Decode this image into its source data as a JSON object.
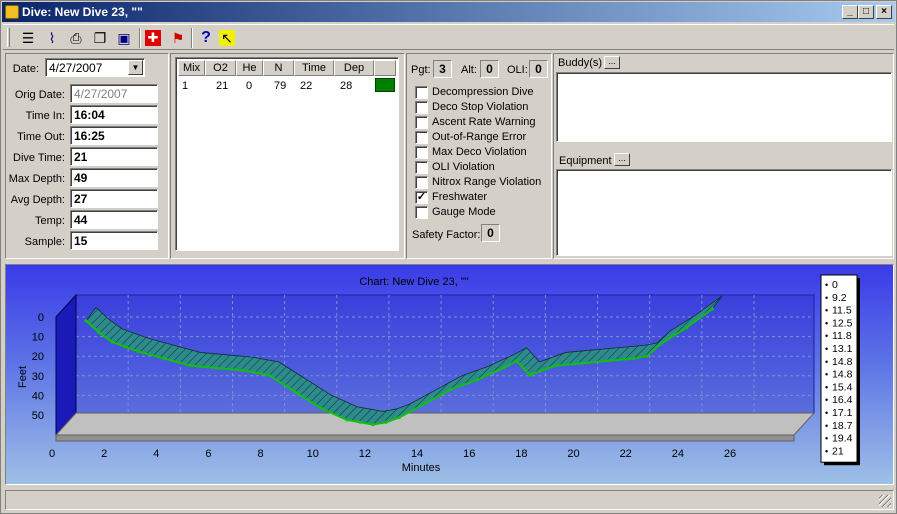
{
  "window": {
    "title": "Dive: New Dive 23, \"\"",
    "controls": [
      "_",
      "□",
      "×"
    ]
  },
  "toolbar": {
    "buttons": [
      {
        "name": "notes-icon",
        "glyph": "☰"
      },
      {
        "name": "chart-icon",
        "glyph": "⌇"
      },
      {
        "name": "print-icon",
        "glyph": "⎙"
      },
      {
        "name": "copy-icon",
        "glyph": "❐"
      },
      {
        "name": "save-icon",
        "glyph": "▣"
      },
      {
        "name": "first-aid-icon",
        "glyph": "✚"
      },
      {
        "name": "flag-icon",
        "glyph": "⚑"
      },
      {
        "name": "help-icon",
        "glyph": "?"
      },
      {
        "name": "pointer-icon",
        "glyph": "↖"
      }
    ]
  },
  "dive_info": {
    "date_label": "Date:",
    "date": "4/27/2007",
    "orig_date_label": "Orig Date:",
    "orig_date": "4/27/2007",
    "time_in_label": "Time In:",
    "time_in": "16:04",
    "time_out_label": "Time Out:",
    "time_out": "16:25",
    "dive_time_label": "Dive Time:",
    "dive_time": "21",
    "max_depth_label": "Max Depth:",
    "max_depth": "49",
    "avg_depth_label": "Avg Depth:",
    "avg_depth": "27",
    "temp_label": "Temp:",
    "temp": "44",
    "sample_label": "Sample:",
    "sample": "15"
  },
  "mix_table": {
    "headers": [
      "Mix",
      "O2",
      "He",
      "N",
      "Time",
      "Dep",
      ""
    ],
    "rows": [
      [
        "1",
        "21",
        "0",
        "79",
        "22",
        "28",
        ""
      ]
    ],
    "row_color": "#008000"
  },
  "status": {
    "pgt_label": "Pgt:",
    "pgt": "3",
    "alt_label": "Alt:",
    "alt": "0",
    "oli_label": "OLI:",
    "oli": "0",
    "safety_factor_label": "Safety Factor:",
    "safety_factor": "0",
    "flags": [
      {
        "label": "Decompression Dive",
        "checked": false
      },
      {
        "label": "Deco Stop Violation",
        "checked": false
      },
      {
        "label": "Ascent Rate Warning",
        "checked": false
      },
      {
        "label": "Out-of-Range Error",
        "checked": false
      },
      {
        "label": "Max Deco Violation",
        "checked": false
      },
      {
        "label": "OLI Violation",
        "checked": false
      },
      {
        "label": "Nitrox Range Violation",
        "checked": false
      },
      {
        "label": "Freshwater",
        "checked": true
      },
      {
        "label": "Gauge Mode",
        "checked": false
      }
    ]
  },
  "buddy": {
    "label": "Buddy(s)",
    "button": "..."
  },
  "equipment": {
    "label": "Equipment",
    "button": "..."
  },
  "chart_data": {
    "type": "area",
    "title": "Chart: New Dive 23, \"\"",
    "xlabel": "Minutes",
    "ylabel": "Feet",
    "xlim": [
      0,
      28
    ],
    "ylim": [
      0,
      50
    ],
    "y_reversed": true,
    "xticks": [
      "0",
      "2",
      "4",
      "6",
      "8",
      "10",
      "12",
      "14",
      "16",
      "18",
      "20",
      "22",
      "24",
      "26"
    ],
    "yticks": [
      "0",
      "10",
      "20",
      "30",
      "40",
      "50"
    ],
    "x": [
      0,
      0.5,
      1,
      1.5,
      2,
      3,
      4,
      5,
      6,
      7,
      8,
      9,
      10,
      10.5,
      11,
      11.5,
      12,
      13,
      14,
      15,
      16,
      16.5,
      17,
      18,
      19,
      20,
      21,
      21.5,
      22,
      23,
      24
    ],
    "y": [
      5,
      10,
      14,
      16,
      18,
      21,
      24,
      25,
      26,
      28,
      35,
      42,
      47,
      48,
      49,
      48,
      46,
      40,
      34,
      30,
      25,
      22,
      28,
      24,
      23,
      22,
      21,
      20,
      15,
      8,
      0
    ],
    "legend": [
      "0",
      "9.2",
      "11.5",
      "12.5",
      "11.8",
      "13.1",
      "14.8",
      "14.8",
      "15.4",
      "16.4",
      "17.1",
      "18.7",
      "19.4",
      "21"
    ],
    "fill_color": "#2e8b8b",
    "line_color": "#10c010",
    "legend_position": "right"
  }
}
